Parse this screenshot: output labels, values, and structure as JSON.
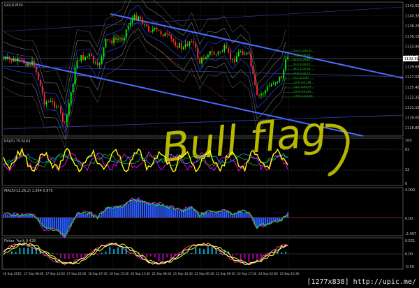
{
  "chart": {
    "symbol_label": "GOLD,M30",
    "price_labels": [
      "1142.50",
      "1140.35",
      "1138.25",
      "1136.10",
      "1133.95",
      "1131.80",
      "1129.65",
      "1127.55",
      "1125.40",
      "1123.25",
      "1121.10",
      "1119.00",
      "1116.85"
    ],
    "current_price": "1132.90",
    "fib_labels": [
      "100.0 1140.35",
      "76.4 1136.39",
      "61.8 1134.89",
      "50.0 1133.95",
      "38.2 1132.96",
      "23.6 1131.72",
      "0.0 1129.80",
      "-23.6 1127.88",
      "-38.2 1126.74",
      "-61.8 1124.81",
      "-100.0 1121.80"
    ],
    "handwriting": "Bull flag"
  },
  "rsi": {
    "label": "RSI(5) 75.6163",
    "levels": [
      "100",
      "82",
      "32",
      "0"
    ]
  },
  "macd": {
    "label": "MACD(12,26,2) 1.094 0.975",
    "levels": [
      "4.002",
      "0.00",
      "-2.097"
    ]
  },
  "fisher": {
    "label": "Fisher_Yurik 0.428",
    "levels": [
      "0.521",
      "0.00",
      "-0.56"
    ]
  },
  "time_labels": [
    "16 Sep 2015",
    "17 Sep 06:00",
    "17 Sep 14:00",
    "17 Sep 22:00",
    "18 Sep 07:30",
    "18 Sep 15:30",
    "20 Sep 23:30",
    "21 Sep 08:30",
    "21 Sep 16:30",
    "22 Sep 00:30",
    "22 Sep 09:30",
    "22 Sep 17:30",
    "23 Sep 02:00",
    "23 Sep 10:30"
  ],
  "colors": {
    "bull": "#00ff00",
    "bear": "#ff3030",
    "yellow": "#ffff00",
    "magenta": "#ff00ff",
    "blue": "#4a6cff",
    "cyan": "#00bfff",
    "handwriting": "#c8c800"
  },
  "footer": {
    "watermark": "[1277x838] http://upic.me/"
  }
}
